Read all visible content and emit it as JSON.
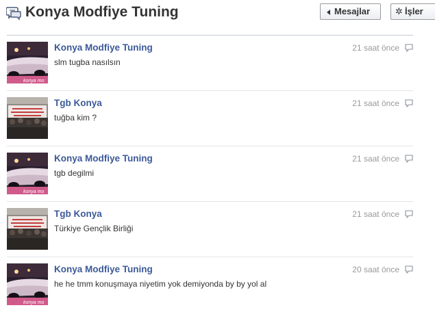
{
  "header": {
    "title": "Konya Modfiye Tuning",
    "back_label": "Mesajlar",
    "actions_label": "İşler",
    "icons": {
      "messages": "messages-icon",
      "back": "back-arrow-icon",
      "actions": "gear-icon"
    }
  },
  "messages": [
    {
      "sender": "Konya Modfiye Tuning",
      "text": "slm tugba nasılsın",
      "time": "21 saat önce",
      "avatar": "car",
      "avatar_caption": "konya mo"
    },
    {
      "sender": "Tgb Konya",
      "text": "tuğba kim ?",
      "time": "21 saat önce",
      "avatar": "crowd",
      "avatar_caption": ""
    },
    {
      "sender": "Konya Modfiye Tuning",
      "text": "tgb degilmi",
      "time": "21 saat önce",
      "avatar": "car",
      "avatar_caption": "konya mo"
    },
    {
      "sender": "Tgb Konya",
      "text": "Türkiye Gençlik Birliği",
      "time": "21 saat önce",
      "avatar": "crowd",
      "avatar_caption": ""
    },
    {
      "sender": "Konya Modfiye Tuning",
      "text": "he he tmm konuşmaya niyetim yok demiyonda by by yol al",
      "time": "20 saat önce",
      "avatar": "car",
      "avatar_caption": "konya mo"
    }
  ],
  "colors": {
    "link": "#3b5998",
    "muted": "#999999",
    "text": "#333333"
  }
}
